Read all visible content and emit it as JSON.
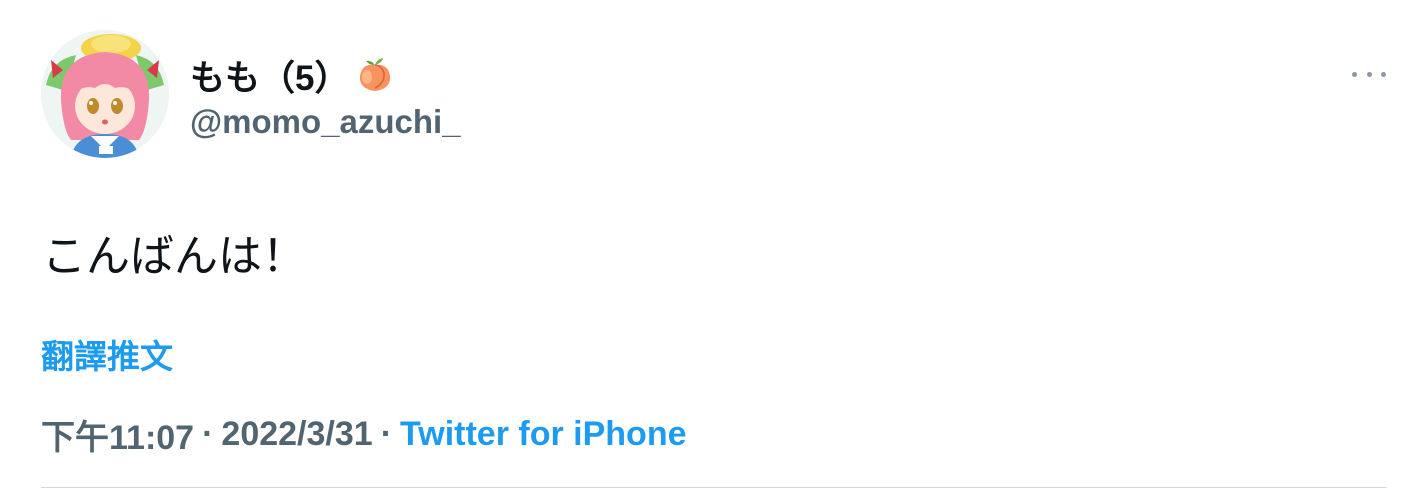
{
  "tweet": {
    "display_name": "もも（5）",
    "name_emoji": "peach-emoji",
    "handle": "@momo_azuchi_",
    "text": "こんばんは！",
    "translate_label": "翻譯推文",
    "time": "下午11:07",
    "separator": "·",
    "date": "2022/3/31",
    "source": "Twitter for iPhone",
    "more_icon": "more-options-icon"
  },
  "colors": {
    "accent": "#1d9bf0",
    "secondary_text": "#536471",
    "primary_text": "#0f1419",
    "divider": "#cfd9de"
  }
}
